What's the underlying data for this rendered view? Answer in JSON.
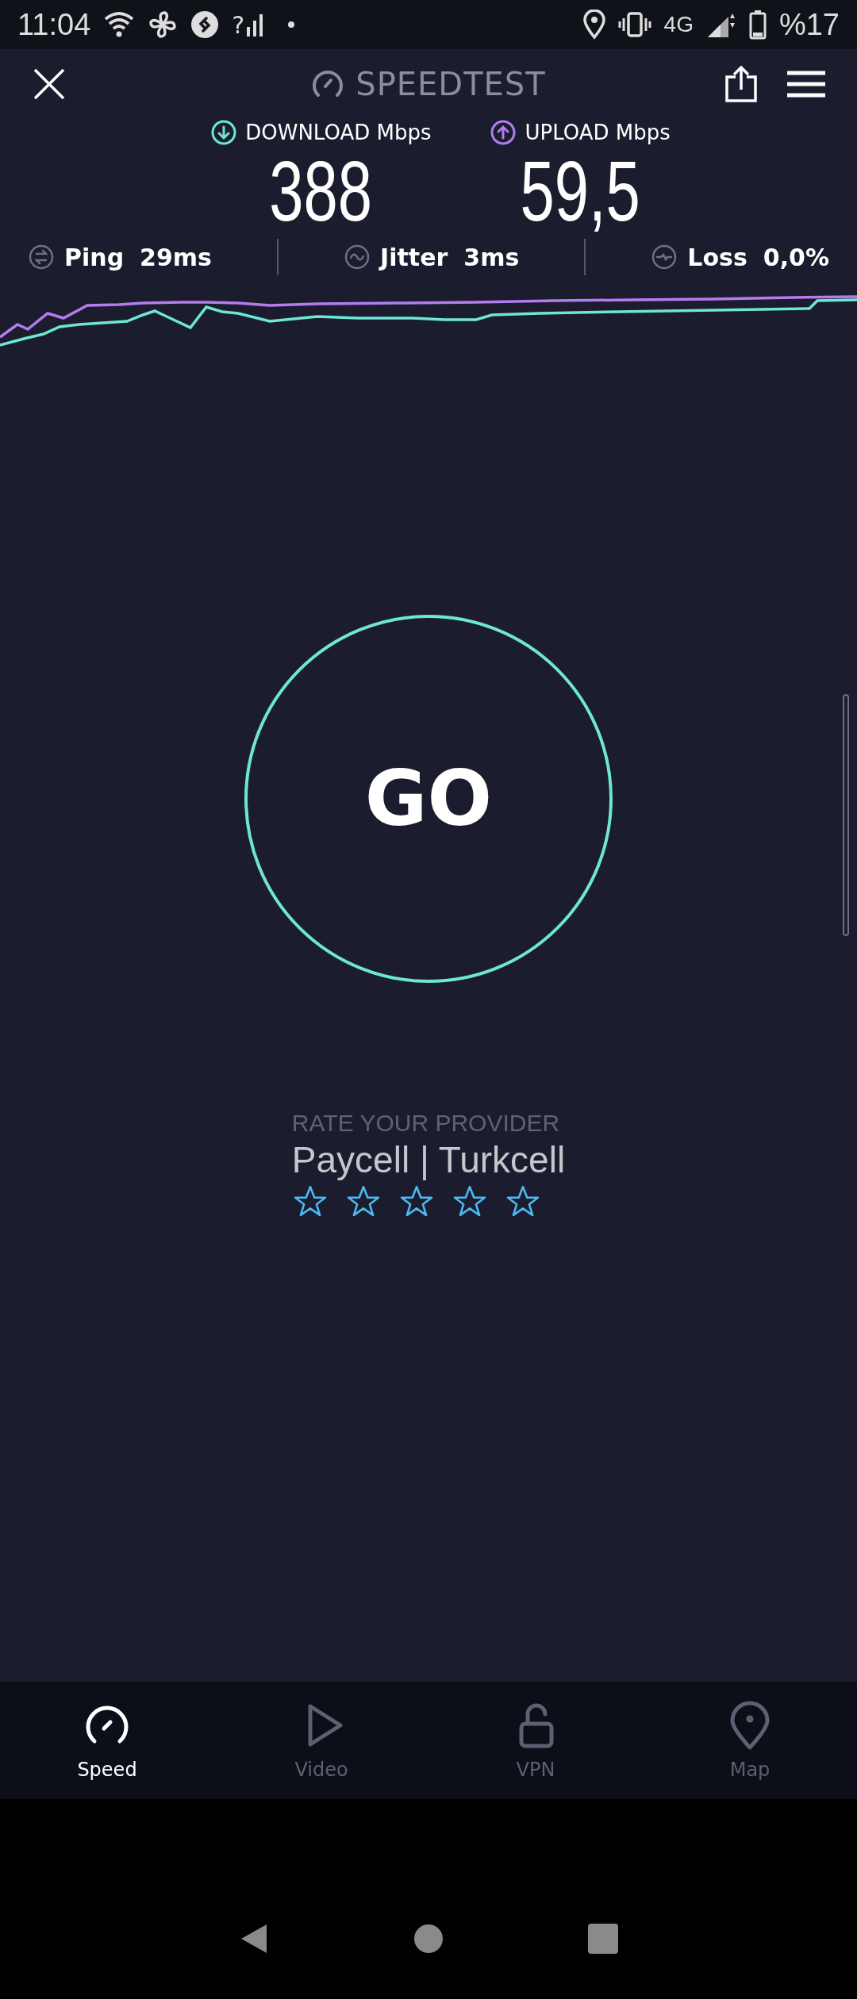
{
  "status_bar": {
    "time": "11:04",
    "sim_mark": "?",
    "network": "4G",
    "battery": "%17"
  },
  "header": {
    "title": "SPEEDTEST"
  },
  "metrics": [
    {
      "kind": "download",
      "label": "DOWNLOAD Mbps",
      "value": "388"
    },
    {
      "kind": "upload",
      "label": "UPLOAD Mbps",
      "value": "59,5"
    }
  ],
  "stats": [
    {
      "kind": "ping",
      "label": "Ping",
      "value": "29ms"
    },
    {
      "kind": "jitter",
      "label": "Jitter",
      "value": "3ms"
    },
    {
      "kind": "loss",
      "label": "Loss",
      "value": "0,0%"
    }
  ],
  "go_button": {
    "label": "GO"
  },
  "rating": {
    "prompt": "RATE YOUR PROVIDER",
    "provider": "Paycell | Turkcell",
    "stars": 0
  },
  "nav": [
    {
      "kind": "speed",
      "label": "Speed",
      "selected": true
    },
    {
      "kind": "video",
      "label": "Video",
      "selected": false
    },
    {
      "kind": "vpn",
      "label": "VPN",
      "selected": false
    },
    {
      "kind": "map",
      "label": "Map",
      "selected": false
    }
  ]
}
